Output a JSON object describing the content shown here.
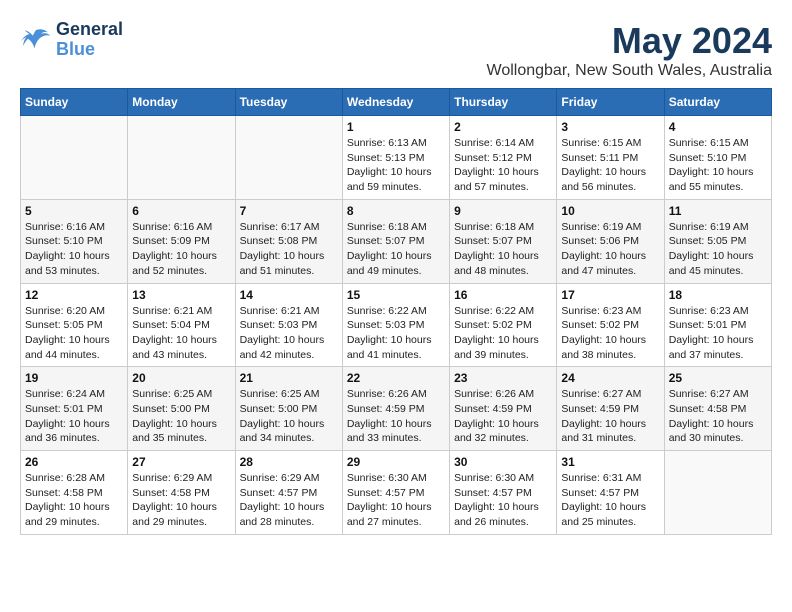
{
  "header": {
    "logo_line1": "General",
    "logo_line2": "Blue",
    "month_title": "May 2024",
    "location": "Wollongbar, New South Wales, Australia"
  },
  "days_of_week": [
    "Sunday",
    "Monday",
    "Tuesday",
    "Wednesday",
    "Thursday",
    "Friday",
    "Saturday"
  ],
  "weeks": [
    [
      {
        "num": "",
        "info": ""
      },
      {
        "num": "",
        "info": ""
      },
      {
        "num": "",
        "info": ""
      },
      {
        "num": "1",
        "info": "Sunrise: 6:13 AM\nSunset: 5:13 PM\nDaylight: 10 hours\nand 59 minutes."
      },
      {
        "num": "2",
        "info": "Sunrise: 6:14 AM\nSunset: 5:12 PM\nDaylight: 10 hours\nand 57 minutes."
      },
      {
        "num": "3",
        "info": "Sunrise: 6:15 AM\nSunset: 5:11 PM\nDaylight: 10 hours\nand 56 minutes."
      },
      {
        "num": "4",
        "info": "Sunrise: 6:15 AM\nSunset: 5:10 PM\nDaylight: 10 hours\nand 55 minutes."
      }
    ],
    [
      {
        "num": "5",
        "info": "Sunrise: 6:16 AM\nSunset: 5:10 PM\nDaylight: 10 hours\nand 53 minutes."
      },
      {
        "num": "6",
        "info": "Sunrise: 6:16 AM\nSunset: 5:09 PM\nDaylight: 10 hours\nand 52 minutes."
      },
      {
        "num": "7",
        "info": "Sunrise: 6:17 AM\nSunset: 5:08 PM\nDaylight: 10 hours\nand 51 minutes."
      },
      {
        "num": "8",
        "info": "Sunrise: 6:18 AM\nSunset: 5:07 PM\nDaylight: 10 hours\nand 49 minutes."
      },
      {
        "num": "9",
        "info": "Sunrise: 6:18 AM\nSunset: 5:07 PM\nDaylight: 10 hours\nand 48 minutes."
      },
      {
        "num": "10",
        "info": "Sunrise: 6:19 AM\nSunset: 5:06 PM\nDaylight: 10 hours\nand 47 minutes."
      },
      {
        "num": "11",
        "info": "Sunrise: 6:19 AM\nSunset: 5:05 PM\nDaylight: 10 hours\nand 45 minutes."
      }
    ],
    [
      {
        "num": "12",
        "info": "Sunrise: 6:20 AM\nSunset: 5:05 PM\nDaylight: 10 hours\nand 44 minutes."
      },
      {
        "num": "13",
        "info": "Sunrise: 6:21 AM\nSunset: 5:04 PM\nDaylight: 10 hours\nand 43 minutes."
      },
      {
        "num": "14",
        "info": "Sunrise: 6:21 AM\nSunset: 5:03 PM\nDaylight: 10 hours\nand 42 minutes."
      },
      {
        "num": "15",
        "info": "Sunrise: 6:22 AM\nSunset: 5:03 PM\nDaylight: 10 hours\nand 41 minutes."
      },
      {
        "num": "16",
        "info": "Sunrise: 6:22 AM\nSunset: 5:02 PM\nDaylight: 10 hours\nand 39 minutes."
      },
      {
        "num": "17",
        "info": "Sunrise: 6:23 AM\nSunset: 5:02 PM\nDaylight: 10 hours\nand 38 minutes."
      },
      {
        "num": "18",
        "info": "Sunrise: 6:23 AM\nSunset: 5:01 PM\nDaylight: 10 hours\nand 37 minutes."
      }
    ],
    [
      {
        "num": "19",
        "info": "Sunrise: 6:24 AM\nSunset: 5:01 PM\nDaylight: 10 hours\nand 36 minutes."
      },
      {
        "num": "20",
        "info": "Sunrise: 6:25 AM\nSunset: 5:00 PM\nDaylight: 10 hours\nand 35 minutes."
      },
      {
        "num": "21",
        "info": "Sunrise: 6:25 AM\nSunset: 5:00 PM\nDaylight: 10 hours\nand 34 minutes."
      },
      {
        "num": "22",
        "info": "Sunrise: 6:26 AM\nSunset: 4:59 PM\nDaylight: 10 hours\nand 33 minutes."
      },
      {
        "num": "23",
        "info": "Sunrise: 6:26 AM\nSunset: 4:59 PM\nDaylight: 10 hours\nand 32 minutes."
      },
      {
        "num": "24",
        "info": "Sunrise: 6:27 AM\nSunset: 4:59 PM\nDaylight: 10 hours\nand 31 minutes."
      },
      {
        "num": "25",
        "info": "Sunrise: 6:27 AM\nSunset: 4:58 PM\nDaylight: 10 hours\nand 30 minutes."
      }
    ],
    [
      {
        "num": "26",
        "info": "Sunrise: 6:28 AM\nSunset: 4:58 PM\nDaylight: 10 hours\nand 29 minutes."
      },
      {
        "num": "27",
        "info": "Sunrise: 6:29 AM\nSunset: 4:58 PM\nDaylight: 10 hours\nand 29 minutes."
      },
      {
        "num": "28",
        "info": "Sunrise: 6:29 AM\nSunset: 4:57 PM\nDaylight: 10 hours\nand 28 minutes."
      },
      {
        "num": "29",
        "info": "Sunrise: 6:30 AM\nSunset: 4:57 PM\nDaylight: 10 hours\nand 27 minutes."
      },
      {
        "num": "30",
        "info": "Sunrise: 6:30 AM\nSunset: 4:57 PM\nDaylight: 10 hours\nand 26 minutes."
      },
      {
        "num": "31",
        "info": "Sunrise: 6:31 AM\nSunset: 4:57 PM\nDaylight: 10 hours\nand 25 minutes."
      },
      {
        "num": "",
        "info": ""
      }
    ]
  ]
}
